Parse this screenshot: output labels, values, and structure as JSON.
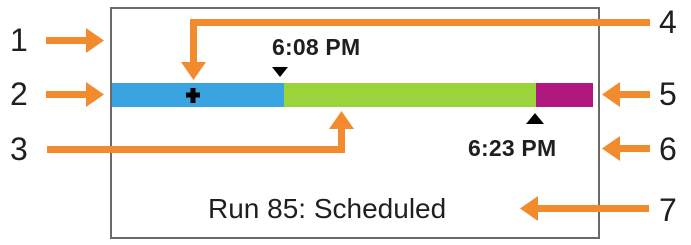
{
  "panel": {
    "start_time": "6:08 PM",
    "end_time": "6:23 PM",
    "status": "Run 85: Scheduled"
  },
  "timeline": {
    "segments": [
      {
        "name": "blue-segment",
        "color": "#3aa4e0"
      },
      {
        "name": "green-segment",
        "color": "#9bd33a"
      },
      {
        "name": "magenta-segment",
        "color": "#b0177f"
      }
    ],
    "plus_icon": "plus-icon"
  },
  "callouts": [
    {
      "number": "1"
    },
    {
      "number": "2"
    },
    {
      "number": "3"
    },
    {
      "number": "4"
    },
    {
      "number": "5"
    },
    {
      "number": "6"
    },
    {
      "number": "7"
    }
  ],
  "colors": {
    "arrow": "#f28a2e",
    "border": "#6a6a6a",
    "text": "#1f1f1f"
  }
}
